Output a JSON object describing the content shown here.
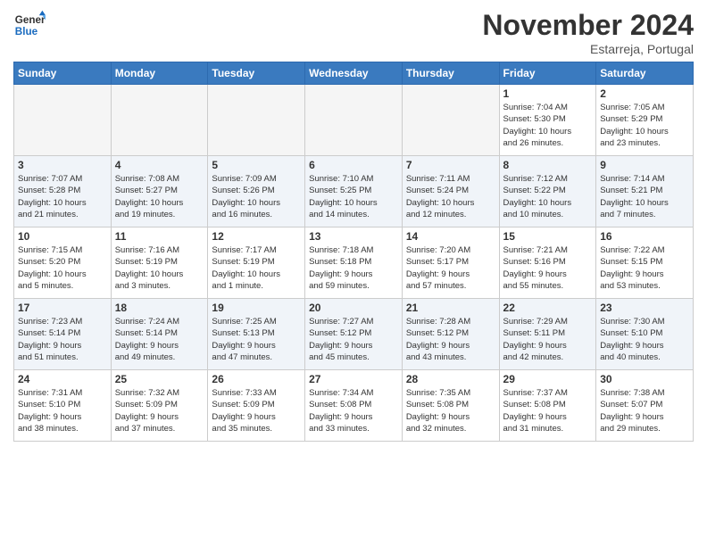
{
  "header": {
    "logo_line1": "General",
    "logo_line2": "Blue",
    "month": "November 2024",
    "location": "Estarreja, Portugal"
  },
  "weekdays": [
    "Sunday",
    "Monday",
    "Tuesday",
    "Wednesday",
    "Thursday",
    "Friday",
    "Saturday"
  ],
  "weeks": [
    [
      {
        "day": "",
        "info": ""
      },
      {
        "day": "",
        "info": ""
      },
      {
        "day": "",
        "info": ""
      },
      {
        "day": "",
        "info": ""
      },
      {
        "day": "",
        "info": ""
      },
      {
        "day": "1",
        "info": "Sunrise: 7:04 AM\nSunset: 5:30 PM\nDaylight: 10 hours\nand 26 minutes."
      },
      {
        "day": "2",
        "info": "Sunrise: 7:05 AM\nSunset: 5:29 PM\nDaylight: 10 hours\nand 23 minutes."
      }
    ],
    [
      {
        "day": "3",
        "info": "Sunrise: 7:07 AM\nSunset: 5:28 PM\nDaylight: 10 hours\nand 21 minutes."
      },
      {
        "day": "4",
        "info": "Sunrise: 7:08 AM\nSunset: 5:27 PM\nDaylight: 10 hours\nand 19 minutes."
      },
      {
        "day": "5",
        "info": "Sunrise: 7:09 AM\nSunset: 5:26 PM\nDaylight: 10 hours\nand 16 minutes."
      },
      {
        "day": "6",
        "info": "Sunrise: 7:10 AM\nSunset: 5:25 PM\nDaylight: 10 hours\nand 14 minutes."
      },
      {
        "day": "7",
        "info": "Sunrise: 7:11 AM\nSunset: 5:24 PM\nDaylight: 10 hours\nand 12 minutes."
      },
      {
        "day": "8",
        "info": "Sunrise: 7:12 AM\nSunset: 5:22 PM\nDaylight: 10 hours\nand 10 minutes."
      },
      {
        "day": "9",
        "info": "Sunrise: 7:14 AM\nSunset: 5:21 PM\nDaylight: 10 hours\nand 7 minutes."
      }
    ],
    [
      {
        "day": "10",
        "info": "Sunrise: 7:15 AM\nSunset: 5:20 PM\nDaylight: 10 hours\nand 5 minutes."
      },
      {
        "day": "11",
        "info": "Sunrise: 7:16 AM\nSunset: 5:19 PM\nDaylight: 10 hours\nand 3 minutes."
      },
      {
        "day": "12",
        "info": "Sunrise: 7:17 AM\nSunset: 5:19 PM\nDaylight: 10 hours\nand 1 minute."
      },
      {
        "day": "13",
        "info": "Sunrise: 7:18 AM\nSunset: 5:18 PM\nDaylight: 9 hours\nand 59 minutes."
      },
      {
        "day": "14",
        "info": "Sunrise: 7:20 AM\nSunset: 5:17 PM\nDaylight: 9 hours\nand 57 minutes."
      },
      {
        "day": "15",
        "info": "Sunrise: 7:21 AM\nSunset: 5:16 PM\nDaylight: 9 hours\nand 55 minutes."
      },
      {
        "day": "16",
        "info": "Sunrise: 7:22 AM\nSunset: 5:15 PM\nDaylight: 9 hours\nand 53 minutes."
      }
    ],
    [
      {
        "day": "17",
        "info": "Sunrise: 7:23 AM\nSunset: 5:14 PM\nDaylight: 9 hours\nand 51 minutes."
      },
      {
        "day": "18",
        "info": "Sunrise: 7:24 AM\nSunset: 5:14 PM\nDaylight: 9 hours\nand 49 minutes."
      },
      {
        "day": "19",
        "info": "Sunrise: 7:25 AM\nSunset: 5:13 PM\nDaylight: 9 hours\nand 47 minutes."
      },
      {
        "day": "20",
        "info": "Sunrise: 7:27 AM\nSunset: 5:12 PM\nDaylight: 9 hours\nand 45 minutes."
      },
      {
        "day": "21",
        "info": "Sunrise: 7:28 AM\nSunset: 5:12 PM\nDaylight: 9 hours\nand 43 minutes."
      },
      {
        "day": "22",
        "info": "Sunrise: 7:29 AM\nSunset: 5:11 PM\nDaylight: 9 hours\nand 42 minutes."
      },
      {
        "day": "23",
        "info": "Sunrise: 7:30 AM\nSunset: 5:10 PM\nDaylight: 9 hours\nand 40 minutes."
      }
    ],
    [
      {
        "day": "24",
        "info": "Sunrise: 7:31 AM\nSunset: 5:10 PM\nDaylight: 9 hours\nand 38 minutes."
      },
      {
        "day": "25",
        "info": "Sunrise: 7:32 AM\nSunset: 5:09 PM\nDaylight: 9 hours\nand 37 minutes."
      },
      {
        "day": "26",
        "info": "Sunrise: 7:33 AM\nSunset: 5:09 PM\nDaylight: 9 hours\nand 35 minutes."
      },
      {
        "day": "27",
        "info": "Sunrise: 7:34 AM\nSunset: 5:08 PM\nDaylight: 9 hours\nand 33 minutes."
      },
      {
        "day": "28",
        "info": "Sunrise: 7:35 AM\nSunset: 5:08 PM\nDaylight: 9 hours\nand 32 minutes."
      },
      {
        "day": "29",
        "info": "Sunrise: 7:37 AM\nSunset: 5:08 PM\nDaylight: 9 hours\nand 31 minutes."
      },
      {
        "day": "30",
        "info": "Sunrise: 7:38 AM\nSunset: 5:07 PM\nDaylight: 9 hours\nand 29 minutes."
      }
    ]
  ]
}
